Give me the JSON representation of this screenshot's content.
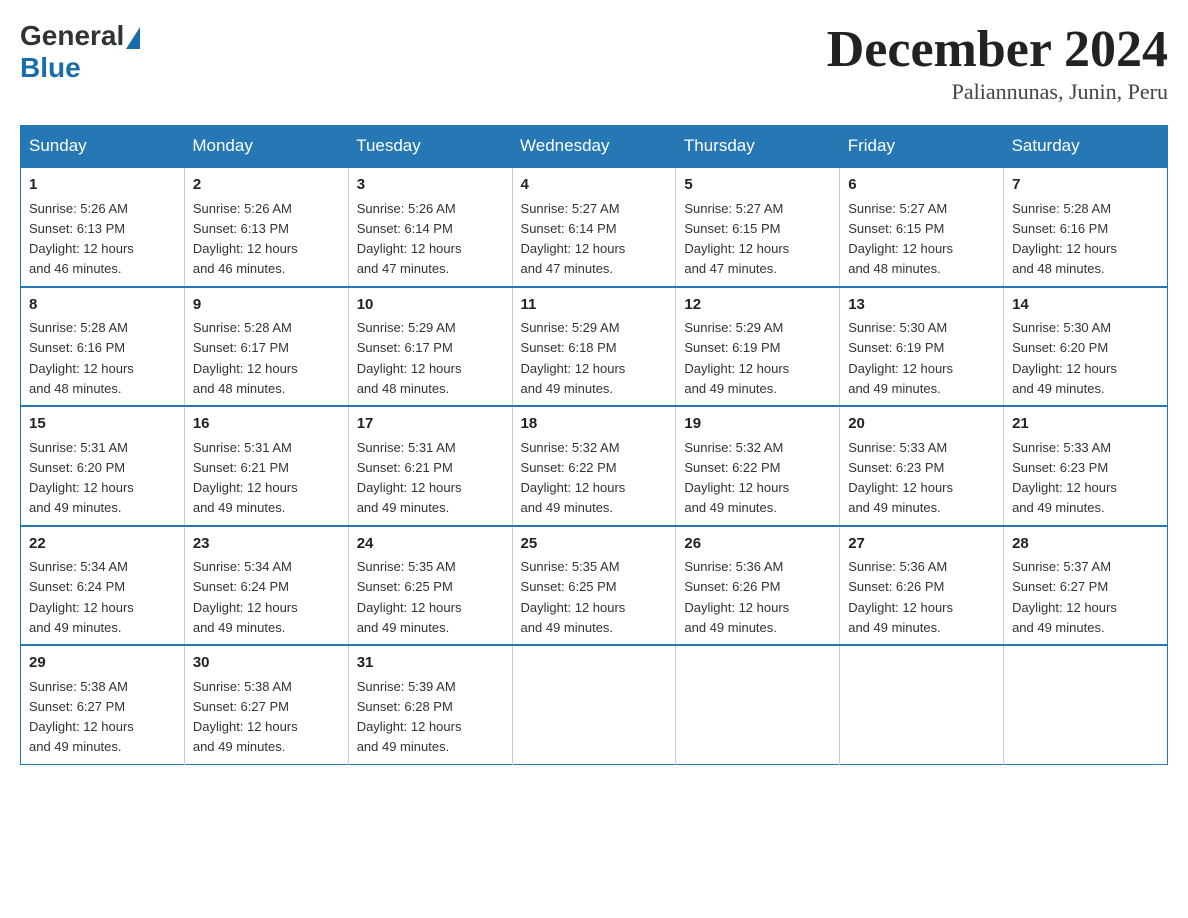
{
  "logo": {
    "general": "General",
    "blue": "Blue"
  },
  "title": "December 2024",
  "location": "Paliannunas, Junin, Peru",
  "days_of_week": [
    "Sunday",
    "Monday",
    "Tuesday",
    "Wednesday",
    "Thursday",
    "Friday",
    "Saturday"
  ],
  "weeks": [
    [
      {
        "day": "1",
        "sunrise": "5:26 AM",
        "sunset": "6:13 PM",
        "daylight": "12 hours and 46 minutes."
      },
      {
        "day": "2",
        "sunrise": "5:26 AM",
        "sunset": "6:13 PM",
        "daylight": "12 hours and 46 minutes."
      },
      {
        "day": "3",
        "sunrise": "5:26 AM",
        "sunset": "6:14 PM",
        "daylight": "12 hours and 47 minutes."
      },
      {
        "day": "4",
        "sunrise": "5:27 AM",
        "sunset": "6:14 PM",
        "daylight": "12 hours and 47 minutes."
      },
      {
        "day": "5",
        "sunrise": "5:27 AM",
        "sunset": "6:15 PM",
        "daylight": "12 hours and 47 minutes."
      },
      {
        "day": "6",
        "sunrise": "5:27 AM",
        "sunset": "6:15 PM",
        "daylight": "12 hours and 48 minutes."
      },
      {
        "day": "7",
        "sunrise": "5:28 AM",
        "sunset": "6:16 PM",
        "daylight": "12 hours and 48 minutes."
      }
    ],
    [
      {
        "day": "8",
        "sunrise": "5:28 AM",
        "sunset": "6:16 PM",
        "daylight": "12 hours and 48 minutes."
      },
      {
        "day": "9",
        "sunrise": "5:28 AM",
        "sunset": "6:17 PM",
        "daylight": "12 hours and 48 minutes."
      },
      {
        "day": "10",
        "sunrise": "5:29 AM",
        "sunset": "6:17 PM",
        "daylight": "12 hours and 48 minutes."
      },
      {
        "day": "11",
        "sunrise": "5:29 AM",
        "sunset": "6:18 PM",
        "daylight": "12 hours and 49 minutes."
      },
      {
        "day": "12",
        "sunrise": "5:29 AM",
        "sunset": "6:19 PM",
        "daylight": "12 hours and 49 minutes."
      },
      {
        "day": "13",
        "sunrise": "5:30 AM",
        "sunset": "6:19 PM",
        "daylight": "12 hours and 49 minutes."
      },
      {
        "day": "14",
        "sunrise": "5:30 AM",
        "sunset": "6:20 PM",
        "daylight": "12 hours and 49 minutes."
      }
    ],
    [
      {
        "day": "15",
        "sunrise": "5:31 AM",
        "sunset": "6:20 PM",
        "daylight": "12 hours and 49 minutes."
      },
      {
        "day": "16",
        "sunrise": "5:31 AM",
        "sunset": "6:21 PM",
        "daylight": "12 hours and 49 minutes."
      },
      {
        "day": "17",
        "sunrise": "5:31 AM",
        "sunset": "6:21 PM",
        "daylight": "12 hours and 49 minutes."
      },
      {
        "day": "18",
        "sunrise": "5:32 AM",
        "sunset": "6:22 PM",
        "daylight": "12 hours and 49 minutes."
      },
      {
        "day": "19",
        "sunrise": "5:32 AM",
        "sunset": "6:22 PM",
        "daylight": "12 hours and 49 minutes."
      },
      {
        "day": "20",
        "sunrise": "5:33 AM",
        "sunset": "6:23 PM",
        "daylight": "12 hours and 49 minutes."
      },
      {
        "day": "21",
        "sunrise": "5:33 AM",
        "sunset": "6:23 PM",
        "daylight": "12 hours and 49 minutes."
      }
    ],
    [
      {
        "day": "22",
        "sunrise": "5:34 AM",
        "sunset": "6:24 PM",
        "daylight": "12 hours and 49 minutes."
      },
      {
        "day": "23",
        "sunrise": "5:34 AM",
        "sunset": "6:24 PM",
        "daylight": "12 hours and 49 minutes."
      },
      {
        "day": "24",
        "sunrise": "5:35 AM",
        "sunset": "6:25 PM",
        "daylight": "12 hours and 49 minutes."
      },
      {
        "day": "25",
        "sunrise": "5:35 AM",
        "sunset": "6:25 PM",
        "daylight": "12 hours and 49 minutes."
      },
      {
        "day": "26",
        "sunrise": "5:36 AM",
        "sunset": "6:26 PM",
        "daylight": "12 hours and 49 minutes."
      },
      {
        "day": "27",
        "sunrise": "5:36 AM",
        "sunset": "6:26 PM",
        "daylight": "12 hours and 49 minutes."
      },
      {
        "day": "28",
        "sunrise": "5:37 AM",
        "sunset": "6:27 PM",
        "daylight": "12 hours and 49 minutes."
      }
    ],
    [
      {
        "day": "29",
        "sunrise": "5:38 AM",
        "sunset": "6:27 PM",
        "daylight": "12 hours and 49 minutes."
      },
      {
        "day": "30",
        "sunrise": "5:38 AM",
        "sunset": "6:27 PM",
        "daylight": "12 hours and 49 minutes."
      },
      {
        "day": "31",
        "sunrise": "5:39 AM",
        "sunset": "6:28 PM",
        "daylight": "12 hours and 49 minutes."
      },
      null,
      null,
      null,
      null
    ]
  ],
  "label_sunrise": "Sunrise:",
  "label_sunset": "Sunset:",
  "label_daylight": "Daylight:"
}
